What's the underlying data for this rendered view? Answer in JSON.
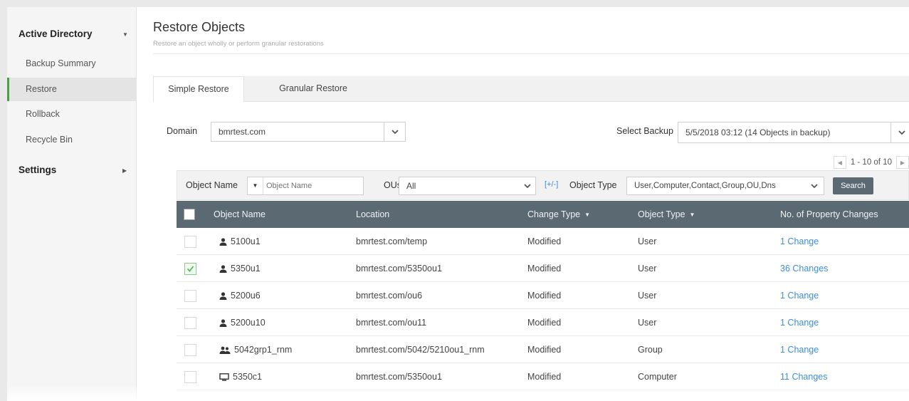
{
  "sidebar": {
    "section_active_directory": "Active Directory",
    "items": [
      "Backup Summary",
      "Restore",
      "Rollback",
      "Recycle Bin"
    ],
    "active_item": "Restore",
    "section_settings": "Settings"
  },
  "page": {
    "title": "Restore Objects",
    "subtitle": "Restore an object wholly or perform granular restorations"
  },
  "tabs": [
    "Simple Restore",
    "Granular Restore"
  ],
  "active_tab": "Simple Restore",
  "domain": {
    "label": "Domain",
    "value": "bmrtest.com"
  },
  "backup": {
    "label": "Select Backup",
    "value": "5/5/2018 03:12 (14 Objects in backup)"
  },
  "pager": {
    "range": "1 - 10 of 10"
  },
  "filters": {
    "object_name_label": "Object Name",
    "object_name_placeholder": "Object Name",
    "ous_label": "OUs",
    "ous_value": "All",
    "toggle": "[+/-]",
    "object_type_label": "Object Type",
    "object_type_value": "User,Computer,Contact,Group,OU,Dns",
    "search_label": "Search"
  },
  "table": {
    "columns": [
      "Object Name",
      "Location",
      "Change Type",
      "Object Type",
      "No. of Property Changes"
    ],
    "rows": [
      {
        "name": "5100u1",
        "icon": "user-icon",
        "location": "bmrtest.com/temp",
        "change": "Modified",
        "type": "User",
        "changes": "1 Change",
        "checked": false
      },
      {
        "name": "5350u1",
        "icon": "user-icon",
        "location": "bmrtest.com/5350ou1",
        "change": "Modified",
        "type": "User",
        "changes": "36 Changes",
        "checked": true
      },
      {
        "name": "5200u6",
        "icon": "user-icon",
        "location": "bmrtest.com/ou6",
        "change": "Modified",
        "type": "User",
        "changes": "1 Change",
        "checked": false
      },
      {
        "name": "5200u10",
        "icon": "user-icon",
        "location": "bmrtest.com/ou11",
        "change": "Modified",
        "type": "User",
        "changes": "1 Change",
        "checked": false
      },
      {
        "name": "5042grp1_rnm",
        "icon": "group-icon",
        "location": "bmrtest.com/5042/5210ou1_rnm",
        "change": "Modified",
        "type": "Group",
        "changes": "1 Change",
        "checked": false
      },
      {
        "name": "5350c1",
        "icon": "computer-icon",
        "location": "bmrtest.com/5350ou1",
        "change": "Modified",
        "type": "Computer",
        "changes": "11 Changes",
        "checked": false
      }
    ]
  },
  "colors": {
    "accent_green": "#46a140",
    "header_bg": "#5b6a72",
    "link": "#3b8ed8"
  }
}
